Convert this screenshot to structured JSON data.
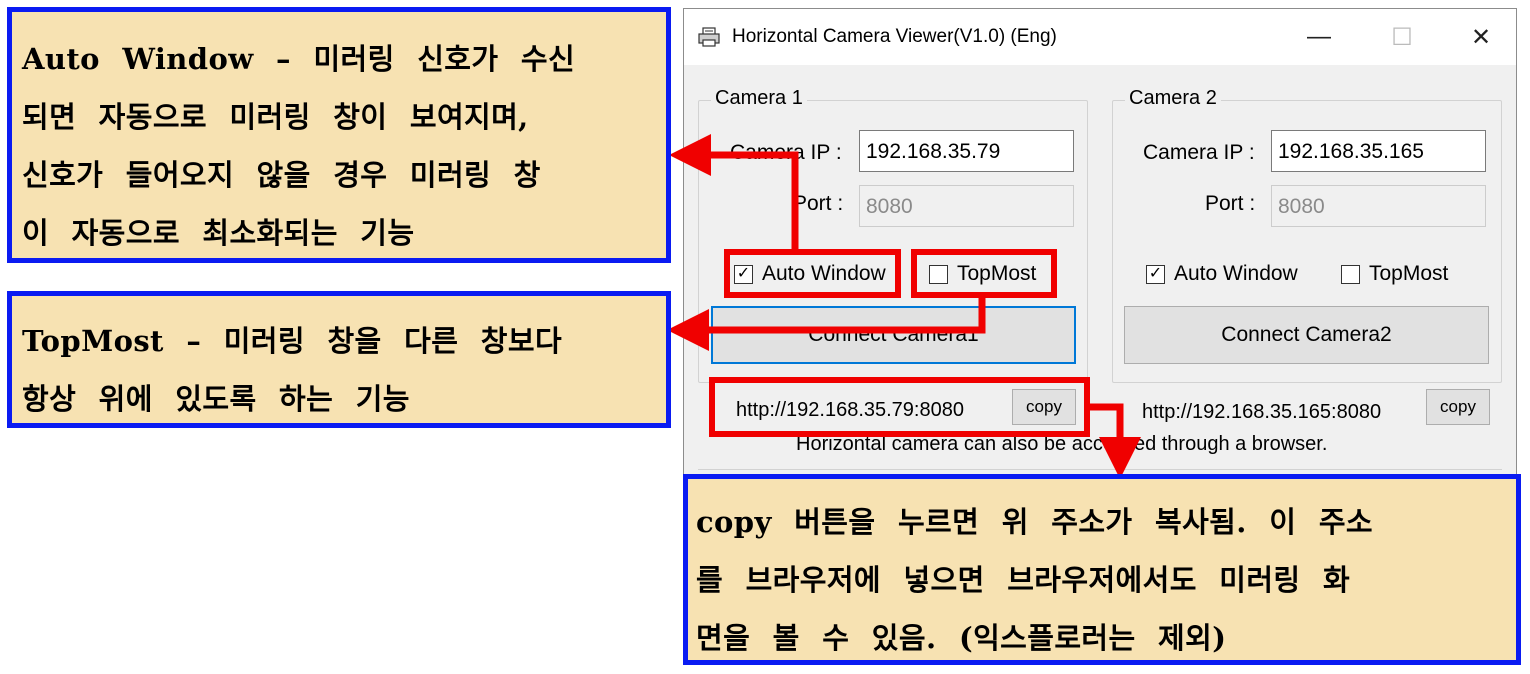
{
  "callouts": {
    "auto_window": [
      "Auto Window – 미러링 신호가 수신",
      "되면 자동으로 미러링 창이 보여지며,",
      "신호가 들어오지 않을 경우 미러링 창",
      "이 자동으로 최소화되는 기능"
    ],
    "topmost": [
      "TopMost – 미러링 창을 다른 창보다",
      "항상 위에 있도록 하는 기능"
    ],
    "copy": [
      "copy 버튼을 누르면 위 주소가 복사됨. 이 주소",
      "를 브라우저에 넣으면 브라우저에서도 미러링 화",
      "면을 볼 수 있음. (익스플로러는 제외)"
    ]
  },
  "window": {
    "title": "Horizontal Camera Viewer(V1.0) (Eng)",
    "app_icon": "printer-icon",
    "controls": {
      "minimize": "—",
      "maximize": "☐",
      "close": "✕"
    },
    "camera1": {
      "group_label": "Camera 1",
      "ip_label": "Camera IP :",
      "ip_value": "192.168.35.79",
      "port_label": "Port :",
      "port_value": "8080",
      "auto_window_label": "Auto Window",
      "auto_window_checked": true,
      "topmost_label": "TopMost",
      "topmost_checked": false,
      "connect_label": "Connect Camera1",
      "url": "http://192.168.35.79:8080",
      "copy_label": "copy"
    },
    "camera2": {
      "group_label": "Camera 2",
      "ip_label": "Camera IP :",
      "ip_value": "192.168.35.165",
      "port_label": "Port :",
      "port_value": "8080",
      "auto_window_label": "Auto Window",
      "auto_window_checked": true,
      "topmost_label": "TopMost",
      "topmost_checked": false,
      "connect_label": "Connect Camera2",
      "url": "http://192.168.35.165:8080",
      "copy_label": "copy"
    },
    "browser_note": "Horizontal camera can also be accessed through a browser."
  },
  "colors": {
    "callout_border": "#0a1bf2",
    "callout_fill": "#f7e2b2",
    "highlight_red": "#f00000",
    "focus_blue": "#0078d7"
  }
}
